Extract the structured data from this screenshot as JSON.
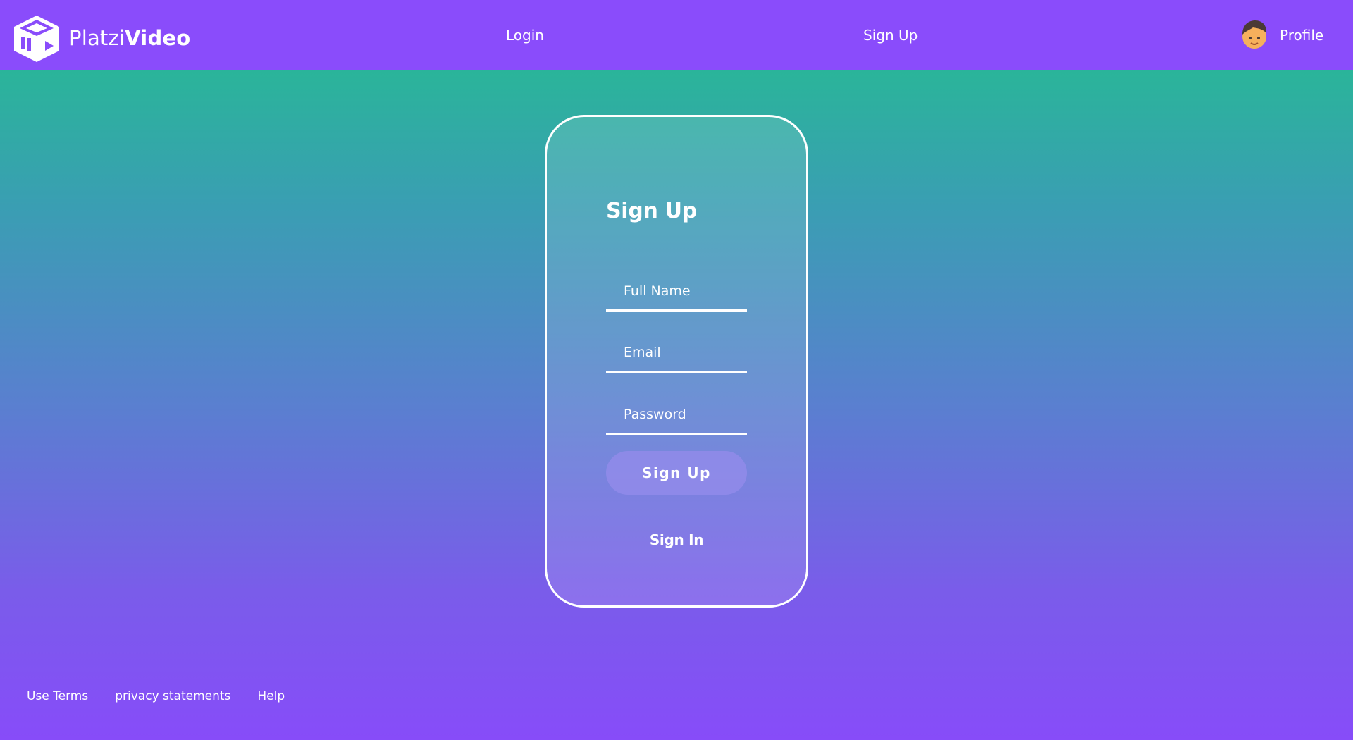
{
  "header": {
    "logo": {
      "icon": "cube-play-icon",
      "text_light": "Platzi",
      "text_bold": "Video"
    },
    "nav": {
      "login_label": "Login",
      "signup_label": "Sign Up"
    },
    "profile": {
      "avatar_icon": "user-avatar-icon",
      "label": "Profile"
    }
  },
  "form": {
    "title": "Sign Up",
    "fields": {
      "full_name": {
        "placeholder": "Full Name",
        "value": ""
      },
      "email": {
        "placeholder": "Email",
        "value": ""
      },
      "password": {
        "placeholder": "Password",
        "value": ""
      }
    },
    "submit_label": "Sign Up",
    "signin_label": "Sign In"
  },
  "footer": {
    "links": [
      "Use Terms",
      "privacy statements",
      "Help"
    ]
  },
  "colors": {
    "header_bg": "#8a4cfb",
    "gradient_top": "#22c08d",
    "gradient_bottom": "#874cf9",
    "text": "#ffffff"
  }
}
